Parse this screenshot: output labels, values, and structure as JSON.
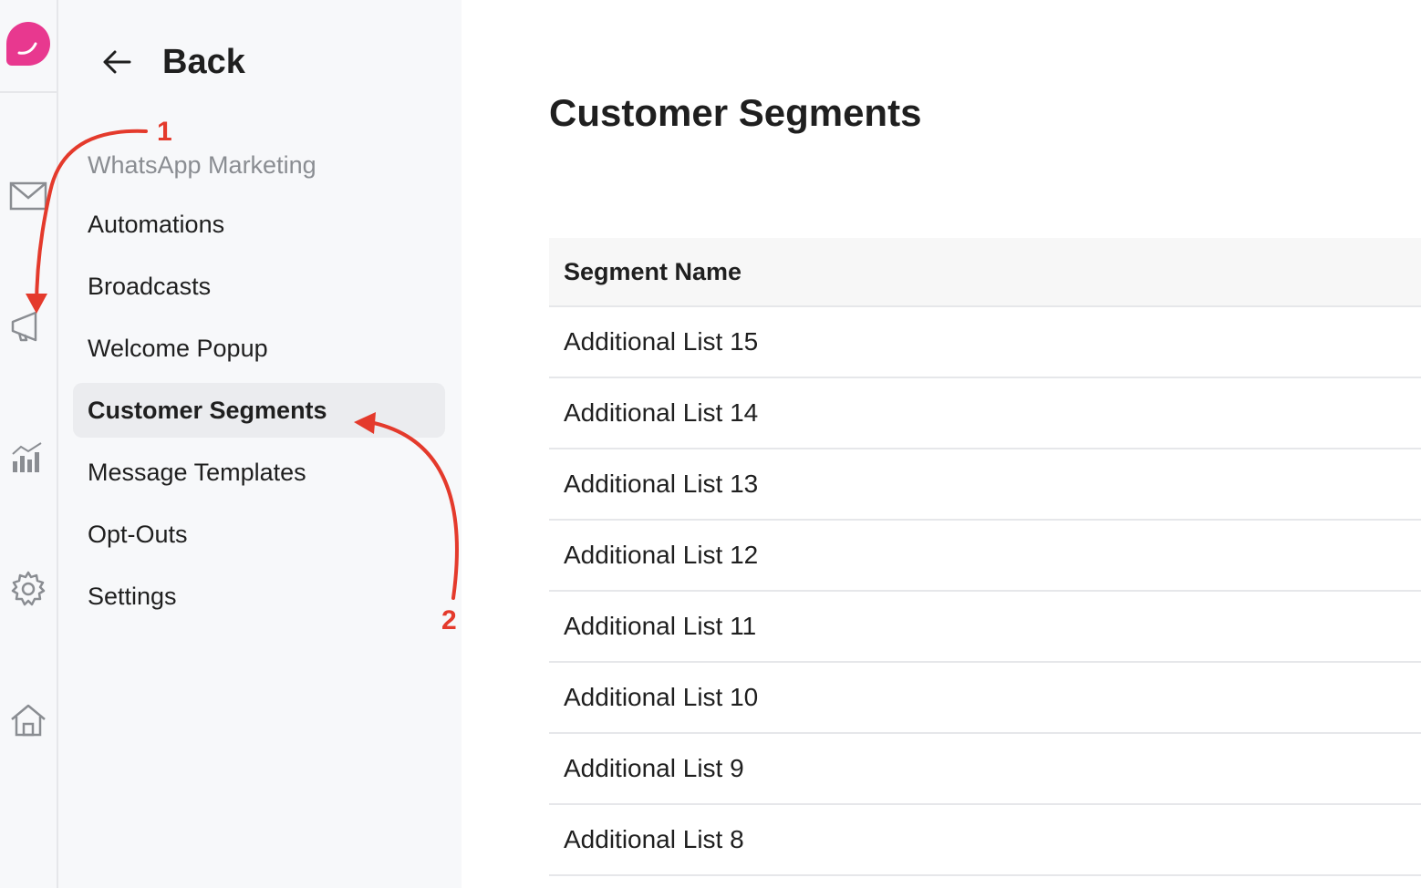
{
  "rail": {
    "icons": [
      "logo-icon",
      "mail-icon",
      "megaphone-icon",
      "analytics-icon",
      "gear-icon",
      "home-icon"
    ]
  },
  "sidebar": {
    "back_label": "Back",
    "section_label": "WhatsApp Marketing",
    "items": [
      {
        "label": "Automations"
      },
      {
        "label": "Broadcasts"
      },
      {
        "label": "Welcome Popup"
      },
      {
        "label": "Customer Segments",
        "active": true
      },
      {
        "label": "Message Templates"
      },
      {
        "label": "Opt-Outs"
      },
      {
        "label": "Settings"
      }
    ]
  },
  "main": {
    "title": "Customer Segments",
    "table": {
      "header": "Segment Name",
      "rows": [
        "Additional List 15",
        "Additional List 14",
        "Additional List 13",
        "Additional List 12",
        "Additional List 11",
        "Additional List 10",
        "Additional List 9",
        "Additional List 8"
      ]
    }
  },
  "annotations": {
    "step1": "1",
    "step2": "2",
    "color": "#e43a2c"
  },
  "colors": {
    "brand": "#e8388f",
    "sidebar_bg": "#f7f8fa",
    "active_bg": "#ebecef"
  }
}
